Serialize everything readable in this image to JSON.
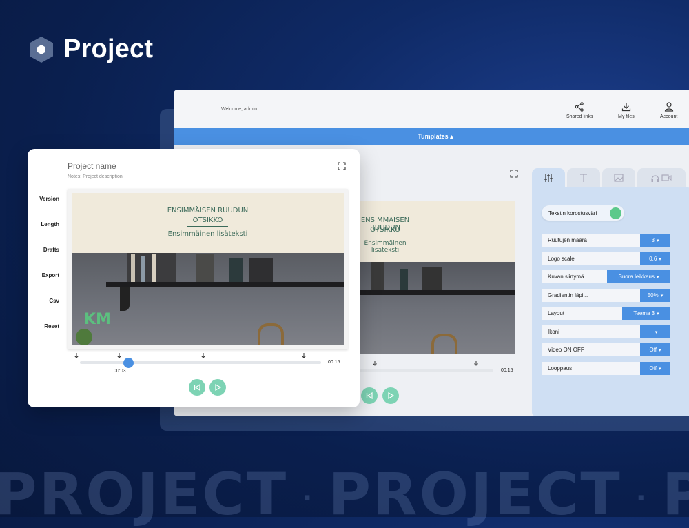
{
  "brand": {
    "title": "Project",
    "logo_icon": "hexagon-logo-icon"
  },
  "watermark": {
    "words": [
      "PROJECT",
      "PROJECT",
      "PROJE"
    ],
    "separator": "·"
  },
  "header": {
    "welcome": "Welcome, admin",
    "nav": [
      {
        "label": "Shared links",
        "icon": "share-icon"
      },
      {
        "label": "My files",
        "icon": "download-icon"
      },
      {
        "label": "Account",
        "icon": "user-icon"
      }
    ]
  },
  "templates_bar": {
    "label": "Tumplates ▴"
  },
  "right_panel": {
    "tabs": [
      {
        "icon": "sliders-icon",
        "active": true
      },
      {
        "icon": "text-icon",
        "active": false
      },
      {
        "icon": "image-icon",
        "active": false
      },
      {
        "icon": "audio-video-icon",
        "active": false
      }
    ],
    "highlight_color": {
      "label": "Tekstin korostusväri",
      "color": "#5cc98b"
    },
    "settings": [
      {
        "label": "Ruutujen määrä",
        "value": "3"
      },
      {
        "label": "Logo scale",
        "value": "0.6"
      },
      {
        "label": "Kuvan siirtymä",
        "value": "Suora leikkaus"
      },
      {
        "label": "Gradientin läpi...",
        "value": "50%"
      },
      {
        "label": "Layout",
        "value": "Teema 3"
      },
      {
        "label": "Ikoni",
        "value": ""
      },
      {
        "label": "Video ON OFF",
        "value": "Off"
      },
      {
        "label": "Looppaus",
        "value": "Off"
      }
    ]
  },
  "back_preview": {
    "headline_1": "ENSIMMÄISEN RUUDUN",
    "headline_2": "OTSIKKO",
    "subtext": "Ensimmäinen lisäteksti",
    "end_time": "00:15"
  },
  "front": {
    "project_name": "Project name",
    "notes": "Notes: Project description",
    "menu": [
      "Version",
      "Length",
      "Drafts",
      "Export",
      "Csv",
      "Reset"
    ],
    "preview": {
      "headline_1": "ENSIMMÄISEN RUUDUN",
      "headline_2": "OTSIKKO",
      "subtext": "Ensimmäinen lisäteksti",
      "logo_text": "KM"
    },
    "playback": {
      "current_time": "00:03",
      "end_time": "00:15",
      "progress": 0.2
    }
  },
  "colors": {
    "accent": "#4a90e2",
    "play_button": "#7dd3b4",
    "toggle": "#5cc98b",
    "headline_text": "#3d6b5a"
  }
}
